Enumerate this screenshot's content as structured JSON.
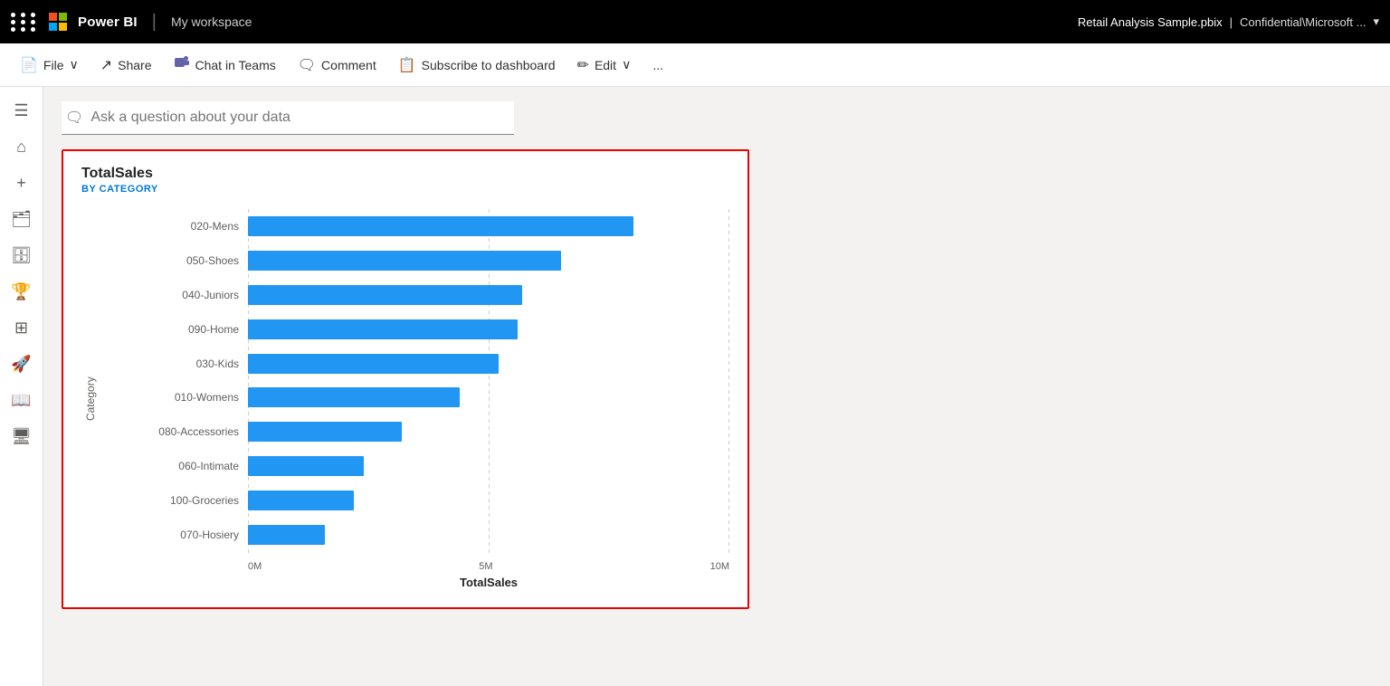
{
  "topbar": {
    "brand": "Power BI",
    "workspace": "My workspace",
    "filename": "Retail Analysis Sample.pbix",
    "confidentiality": "Confidential\\Microsoft ...",
    "dropdown_icon": "▾"
  },
  "navbar": {
    "items": [
      {
        "id": "file",
        "label": "File",
        "icon": "📄",
        "has_chevron": true
      },
      {
        "id": "share",
        "label": "Share",
        "icon": "↗"
      },
      {
        "id": "chat-in-teams",
        "label": "Chat in Teams",
        "icon": "💬"
      },
      {
        "id": "comment",
        "label": "Comment",
        "icon": "🗨"
      },
      {
        "id": "subscribe",
        "label": "Subscribe to dashboard",
        "icon": "📋"
      },
      {
        "id": "edit",
        "label": "Edit",
        "icon": "✏",
        "has_chevron": true
      },
      {
        "id": "more",
        "label": "...",
        "icon": ""
      }
    ]
  },
  "sidebar": {
    "items": [
      {
        "id": "hamburger",
        "icon": "☰"
      },
      {
        "id": "home",
        "icon": "⌂"
      },
      {
        "id": "create",
        "icon": "+"
      },
      {
        "id": "browse",
        "icon": "🗂"
      },
      {
        "id": "data",
        "icon": "🗄"
      },
      {
        "id": "goals",
        "icon": "🏆"
      },
      {
        "id": "apps",
        "icon": "⊞"
      },
      {
        "id": "learn",
        "icon": "🚀"
      },
      {
        "id": "settings",
        "icon": "📖"
      },
      {
        "id": "help",
        "icon": "🖥"
      }
    ]
  },
  "qa_bar": {
    "placeholder": "Ask a question about your data",
    "icon": "🗨"
  },
  "chart": {
    "title": "TotalSales",
    "subtitle": "BY CATEGORY",
    "y_axis_label": "Category",
    "x_axis_label": "TotalSales",
    "x_ticks": [
      "0M",
      "5M",
      "10M"
    ],
    "max_value": 10,
    "bars": [
      {
        "label": "020-Mens",
        "value": 8.0
      },
      {
        "label": "050-Shoes",
        "value": 6.5
      },
      {
        "label": "040-Juniors",
        "value": 5.7
      },
      {
        "label": "090-Home",
        "value": 5.6
      },
      {
        "label": "030-Kids",
        "value": 5.2
      },
      {
        "label": "010-Womens",
        "value": 4.4
      },
      {
        "label": "080-Accessories",
        "value": 3.2
      },
      {
        "label": "060-Intimate",
        "value": 2.4
      },
      {
        "label": "100-Groceries",
        "value": 2.2
      },
      {
        "label": "070-Hosiery",
        "value": 1.6
      }
    ],
    "bar_color": "#2196f3"
  }
}
